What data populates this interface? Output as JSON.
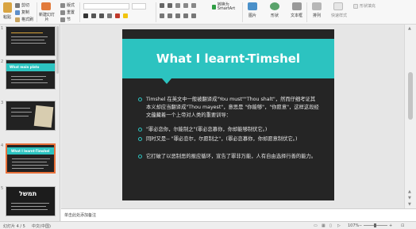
{
  "ribbon": {
    "paste_label": "粘贴",
    "cut_label": "剪切",
    "copy_label": "复制",
    "format_painter_label": "格式刷",
    "new_slide_label": "新建幻灯片",
    "layout_label": "版式",
    "reset_label": "重置",
    "section_label": "节",
    "picture_label": "图片",
    "shape_label": "形状",
    "textbox_label": "文本框",
    "arrange_label": "排列",
    "smartart_label": "转换为SmartArt",
    "quick_style_label": "快速样式",
    "shape_fill_label": "形状填充"
  },
  "thumbnails": [
    {
      "number": "1",
      "title": ""
    },
    {
      "number": "2",
      "title": "What  main plato"
    },
    {
      "number": "3",
      "title": ""
    },
    {
      "number": "4",
      "title": "What I learnt-Timshel"
    },
    {
      "number": "5",
      "title": "תמשל"
    }
  ],
  "slide": {
    "title": "What I learnt-Timshel",
    "bullets": [
      "Timshel 在英文中一般被翻译成\"You must\"\"Thou shalt\"，然而仔细考证其本义却应当翻译成\"Thou mayest\"，意思是 \"你能够\"，\"你愿意\"，这样这段经文蕴藏着一个上帝对人类的重要训导：",
      "\"罪必恋你，尔能制之\"(罪必恋慕你，你却能够制伏它。)",
      "同时又是-- \"罪必恋尔，尔愿制之\"，(罪必恋慕你，你却愿意制伏它。)",
      "它打破了以恶制恶的报应循环，宣告了罪非万能，人有自由选择行善的能力。"
    ],
    "colors": {
      "accent": "#2cc3c0",
      "background": "#252525"
    }
  },
  "notes": {
    "placeholder": "单击此处添加备注"
  },
  "status": {
    "slide_counter": "幻灯片 4 / 5",
    "language": "中文(中国)",
    "zoom": "107%"
  }
}
